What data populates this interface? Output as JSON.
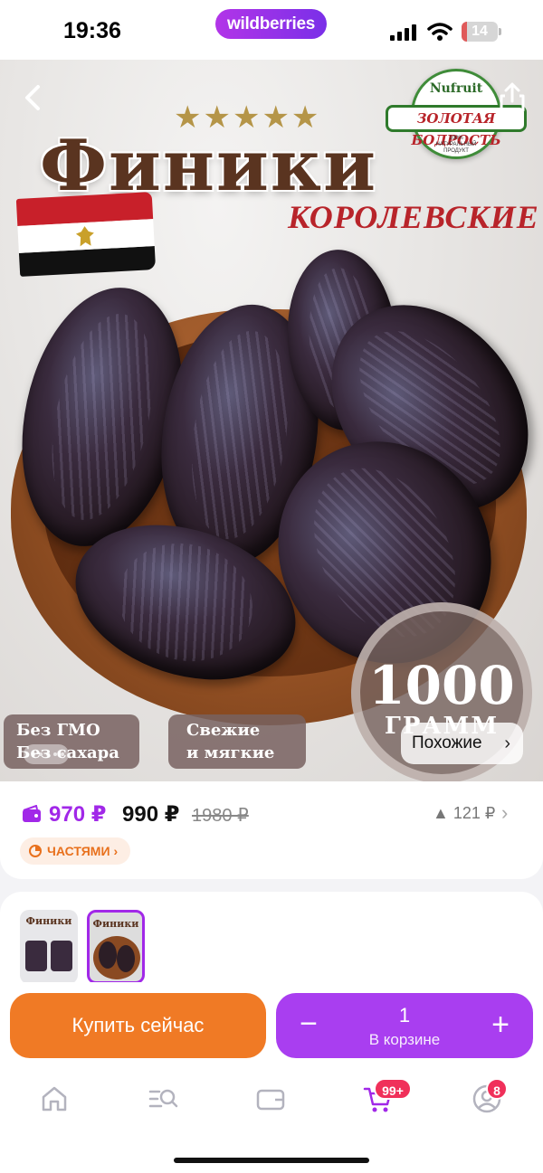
{
  "status_bar": {
    "time": "19:36",
    "brand": "wildberries",
    "battery_percent": 14,
    "icons": [
      "signal-icon",
      "wifi-icon",
      "battery-icon"
    ]
  },
  "hero": {
    "stars_count": 5,
    "stars": "★★★★★",
    "title": "Финики",
    "subtitle": "КОРОЛЕВСКИЕ",
    "brand_badge": {
      "top": "Nufruit",
      "name": "ЗОЛОТАЯ БОДРОСТЬ",
      "note": "100% НАТУРАЛЬНЫЙ ПРОДУКТ"
    },
    "weight_number": "1000",
    "weight_unit": "ГРАММ",
    "tags": [
      {
        "line1": "Без ГМО",
        "line2": "Без сахара"
      },
      {
        "line1": "Свежие",
        "line2": "и мягкие"
      }
    ],
    "similar_label": "Похожие",
    "chevron": "›",
    "colors": {
      "accent": "#a128e8",
      "title": "#5a3420",
      "subtitle": "#b8242a"
    }
  },
  "price": {
    "wallet_price": "970 ₽",
    "current_price": "990 ₽",
    "old_price": "1980 ₽",
    "price_change": "121 ₽",
    "installments_label": "ЧАСТЯМИ",
    "chevron": "›",
    "up_arrow": "▲"
  },
  "thumbnails": [
    {
      "title": "Финики",
      "selected": false
    },
    {
      "title": "Финики",
      "selected": true
    }
  ],
  "buy_bar": {
    "buy_now_label": "Купить сейчас",
    "cart_quantity": "1",
    "cart_label": "В корзине",
    "minus": "−",
    "plus": "+"
  },
  "tab_bar": {
    "tabs": [
      {
        "name": "home",
        "icon": "home-icon"
      },
      {
        "name": "catalog",
        "icon": "search-list-icon"
      },
      {
        "name": "wallet",
        "icon": "wallet-icon"
      },
      {
        "name": "cart",
        "icon": "cart-icon",
        "badge": "99+"
      },
      {
        "name": "profile",
        "icon": "profile-icon",
        "badge": "8"
      }
    ]
  }
}
